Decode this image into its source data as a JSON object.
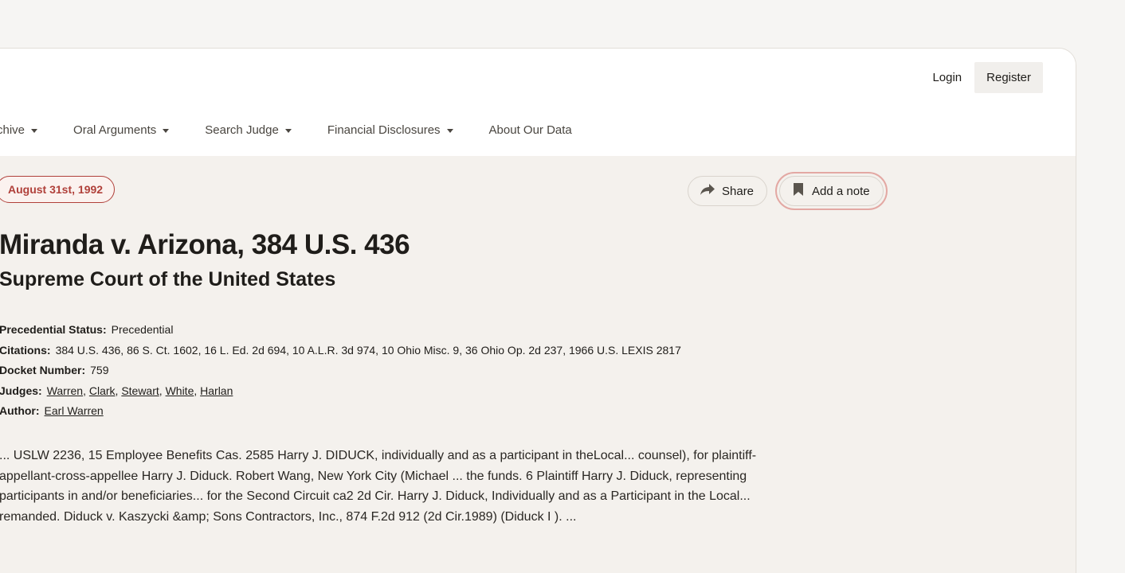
{
  "header": {
    "login_label": "Login",
    "register_label": "Register"
  },
  "nav": {
    "items": [
      {
        "label": "Archive",
        "has_dropdown": true
      },
      {
        "label": "Oral Arguments",
        "has_dropdown": true
      },
      {
        "label": "Search Judge",
        "has_dropdown": true
      },
      {
        "label": "Financial Disclosures",
        "has_dropdown": true
      },
      {
        "label": "About Our Data",
        "has_dropdown": false
      }
    ]
  },
  "case": {
    "date_badge": "August 31st, 1992",
    "title": "Miranda v. Arizona, 384 U.S. 436",
    "court": "Supreme Court of the United States",
    "actions": {
      "share_label": "Share",
      "share_icon": "share-arrow-icon",
      "note_label": "Add a note",
      "note_icon": "bookmark-icon"
    },
    "metadata": {
      "status_label": "Precedential Status:",
      "status_value": "Precedential",
      "citations_label": "Citations:",
      "citations_value": "384 U.S. 436, 86 S. Ct. 1602, 16 L. Ed. 2d 694, 10 A.L.R. 3d 974, 10 Ohio Misc. 9, 36 Ohio Op. 2d 237, 1966 U.S. LEXIS 2817",
      "docket_label": "Docket Number:",
      "docket_value": "759",
      "judges_label": "Judges:",
      "judges": [
        "Warren",
        "Clark",
        "Stewart",
        "White",
        "Harlan"
      ],
      "author_label": "Author:",
      "author_value": "Earl Warren"
    },
    "snippet_lines": [
      "... USLW 2236, 15 Employee Benefits Cas. 2585 Harry J. DIDUCK, individually and as a participant in theLocal... counsel), for plaintiff-",
      "appellant-cross-appellee Harry J. Diduck. Robert Wang, New York City (Michael ... the funds. 6 Plaintiff Harry J. Diduck, representing",
      "participants in and/or beneficiaries... for the Second Circuit ca2 2d Cir. Harry J. Diduck, Individually and as a Participant in the Local...",
      "remanded. Diduck v. Kaszycki &amp; Sons Contractors, Inc., 874 F.2d 912 (2d Cir.1989) (Diduck I ). ..."
    ]
  },
  "colors": {
    "accent": "#b0403a",
    "page_bg": "#f4f1ed",
    "topbar_bg": "#ffffff",
    "note_focus_ring": "#e3a8a3"
  }
}
